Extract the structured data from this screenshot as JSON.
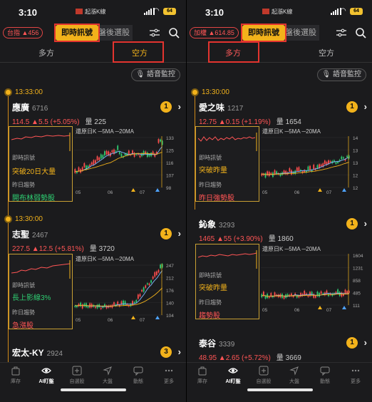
{
  "left": {
    "status": {
      "time": "3:10",
      "carrier": "起漲K線",
      "battery": "64"
    },
    "index_badge": "台指 ▲456",
    "tab_now": "即時訊號",
    "tab_after": "盤後選股",
    "dir_tabs": [
      "多方",
      "空方"
    ],
    "active_dir": "空方",
    "voice": "語音監控",
    "groups": [
      {
        "time": "13:33:00",
        "name": "應廣",
        "code": "6716",
        "badge": "1",
        "price": "114.5 ▲5.5 (+5.05%)",
        "volume": "量 225",
        "signal_label": "即時訊號",
        "signal": "突破20日大量",
        "trend_label": "昨日趨勢",
        "trend": "開布林弱勢股",
        "legend": "還原日K  ─5MA  ─20MA",
        "yticks": [
          "133",
          "125",
          "116",
          "107",
          "98"
        ],
        "xticks": [
          "05",
          "06",
          "07"
        ]
      },
      {
        "time": "13:30:00",
        "name": "志聖",
        "code": "2467",
        "badge": "1",
        "price": "227.5 ▲12.5 (+5.81%)",
        "volume": "量 3720",
        "signal_label": "即時訊號",
        "signal": "長上影線3%",
        "trend_label": "昨日趨勢",
        "trend": "急漲股",
        "legend": "還原日K  ─5MA  ─20MA",
        "yticks": [
          "247",
          "212",
          "176",
          "140",
          "104"
        ],
        "xticks": [
          "05",
          "06",
          "07"
        ]
      },
      {
        "name": "宏太-KY",
        "code": "2924",
        "badge": "3"
      }
    ]
  },
  "right": {
    "status": {
      "time": "3:10",
      "carrier": "起漲K線",
      "battery": "64"
    },
    "index_badge": "加權 ▲614.85",
    "tab_now": "即時訊號",
    "tab_after": "盤後選股",
    "dir_tabs": [
      "多方",
      "空方"
    ],
    "active_dir": "多方",
    "voice": "語音監控",
    "groups": [
      {
        "time": "13:30:00",
        "name": "愛之味",
        "code": "1217",
        "badge": "1",
        "price": "12.75 ▲0.15 (+1.19%)",
        "volume": "量 1654",
        "signal_label": "即時訊號",
        "signal": "突破昨量",
        "trend_label": "昨日趨勢",
        "trend": "昨日強勢股",
        "legend": "還原日K  ─5MA  ─20MA",
        "yticks": [
          "14",
          "13",
          "13",
          "12",
          "12"
        ],
        "xticks": [
          "05",
          "06",
          "07"
        ]
      },
      {
        "name": "鈊象",
        "code": "3293",
        "badge": "1",
        "price": "1465 ▲55 (+3.90%)",
        "volume": "量 1860",
        "signal_label": "即時訊號",
        "signal": "突破昨量",
        "trend_label": "昨日趨勢",
        "trend": "趨勢股",
        "legend": "還原日K  ─5MA  ─20MA",
        "yticks": [
          "1604",
          "1231",
          "858",
          "485",
          "111"
        ],
        "xticks": [
          "05",
          "06",
          "07"
        ]
      },
      {
        "name": "泰谷",
        "code": "3339",
        "badge": "1",
        "price": "48.95 ▲2.65 (+5.72%)",
        "volume": "量 3669"
      }
    ]
  },
  "tabbar": [
    "庫存",
    "AI盯盤",
    "自選股",
    "大盤",
    "動態",
    "更多"
  ],
  "colors": {
    "accent": "#f2b21b",
    "up": "#ff5555",
    "down": "#2ecc71",
    "box": "#e3342f"
  }
}
